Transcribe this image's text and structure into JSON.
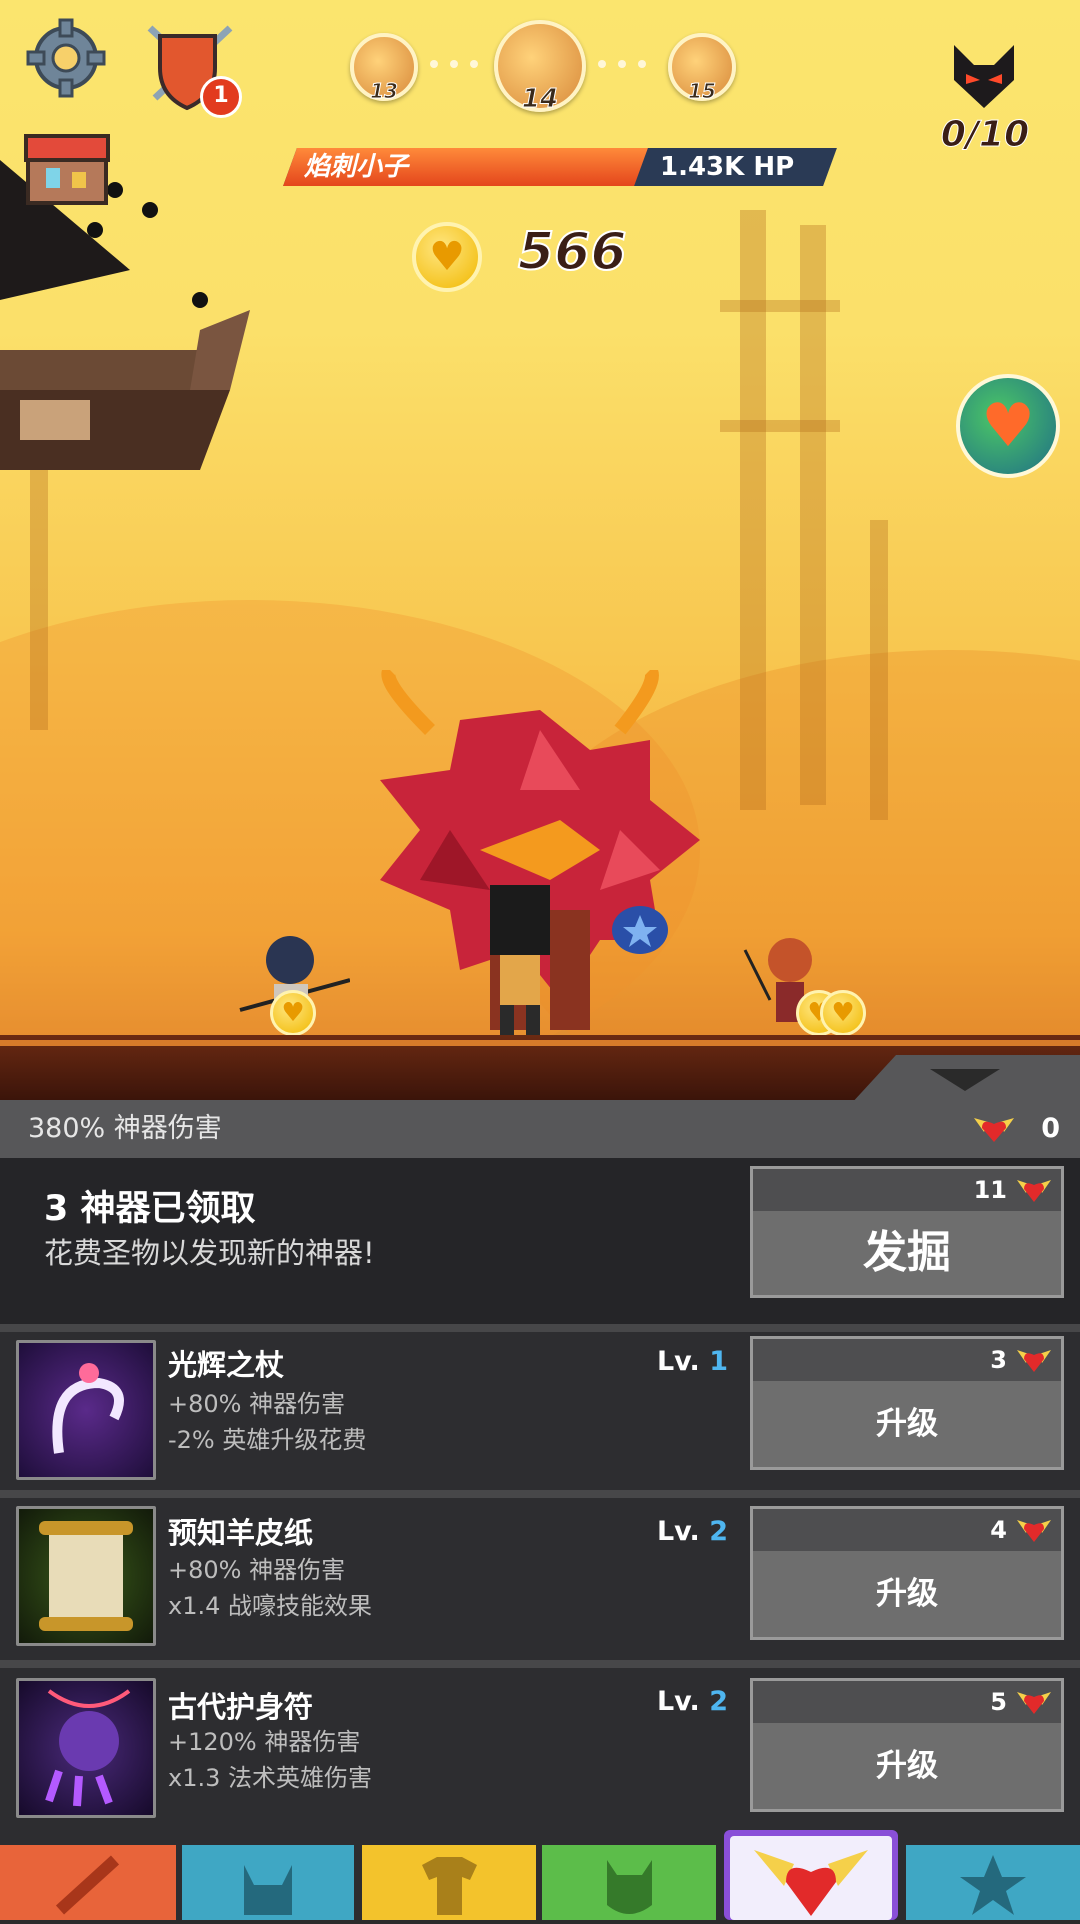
{
  "hud": {
    "notification_count": "1",
    "stages": [
      {
        "number": "13"
      },
      {
        "number": "14"
      },
      {
        "number": "15"
      }
    ],
    "boss_progress": "0/10",
    "enemy_name": "焰刺小子",
    "enemy_hp": "1.43K HP",
    "enemy_hp_fraction": 0.65,
    "relic_currency": "566"
  },
  "artifacts_panel": {
    "damage_bonus": "380% 神器伤害",
    "relic_count": "0",
    "claimed_title": "3 神器已领取",
    "claimed_sub": "花费圣物以发现新的神器!",
    "dig_cost": "11",
    "dig_label": "发掘",
    "items": [
      {
        "name": "光辉之杖",
        "effect1": "+80% 神器伤害",
        "effect2": "-2% 英雄升级花费",
        "lv_prefix": "Lv. ",
        "lv": "1",
        "cost": "3",
        "button": "升级"
      },
      {
        "name": "预知羊皮纸",
        "effect1": "+80% 神器伤害",
        "effect2": "x1.4 战嚎技能效果",
        "lv_prefix": "Lv. ",
        "lv": "2",
        "cost": "4",
        "button": "升级"
      },
      {
        "name": "古代护身符",
        "effect1": "+120% 神器伤害",
        "effect2": "x1.3 法术英雄伤害",
        "lv_prefix": "Lv. ",
        "lv": "2",
        "cost": "5",
        "button": "升级"
      }
    ]
  },
  "tabs": [
    {
      "icon": "sword-icon",
      "color": "#e8643a"
    },
    {
      "icon": "viking-helmet-icon",
      "color": "#3fa7c4"
    },
    {
      "icon": "armor-shirt-icon",
      "color": "#f3c32c"
    },
    {
      "icon": "pet-icon",
      "color": "#5cbd4a"
    },
    {
      "icon": "winged-heart-icon",
      "color": "#8a4fd8"
    },
    {
      "icon": "star-icon",
      "color": "#3fa7c4"
    }
  ]
}
